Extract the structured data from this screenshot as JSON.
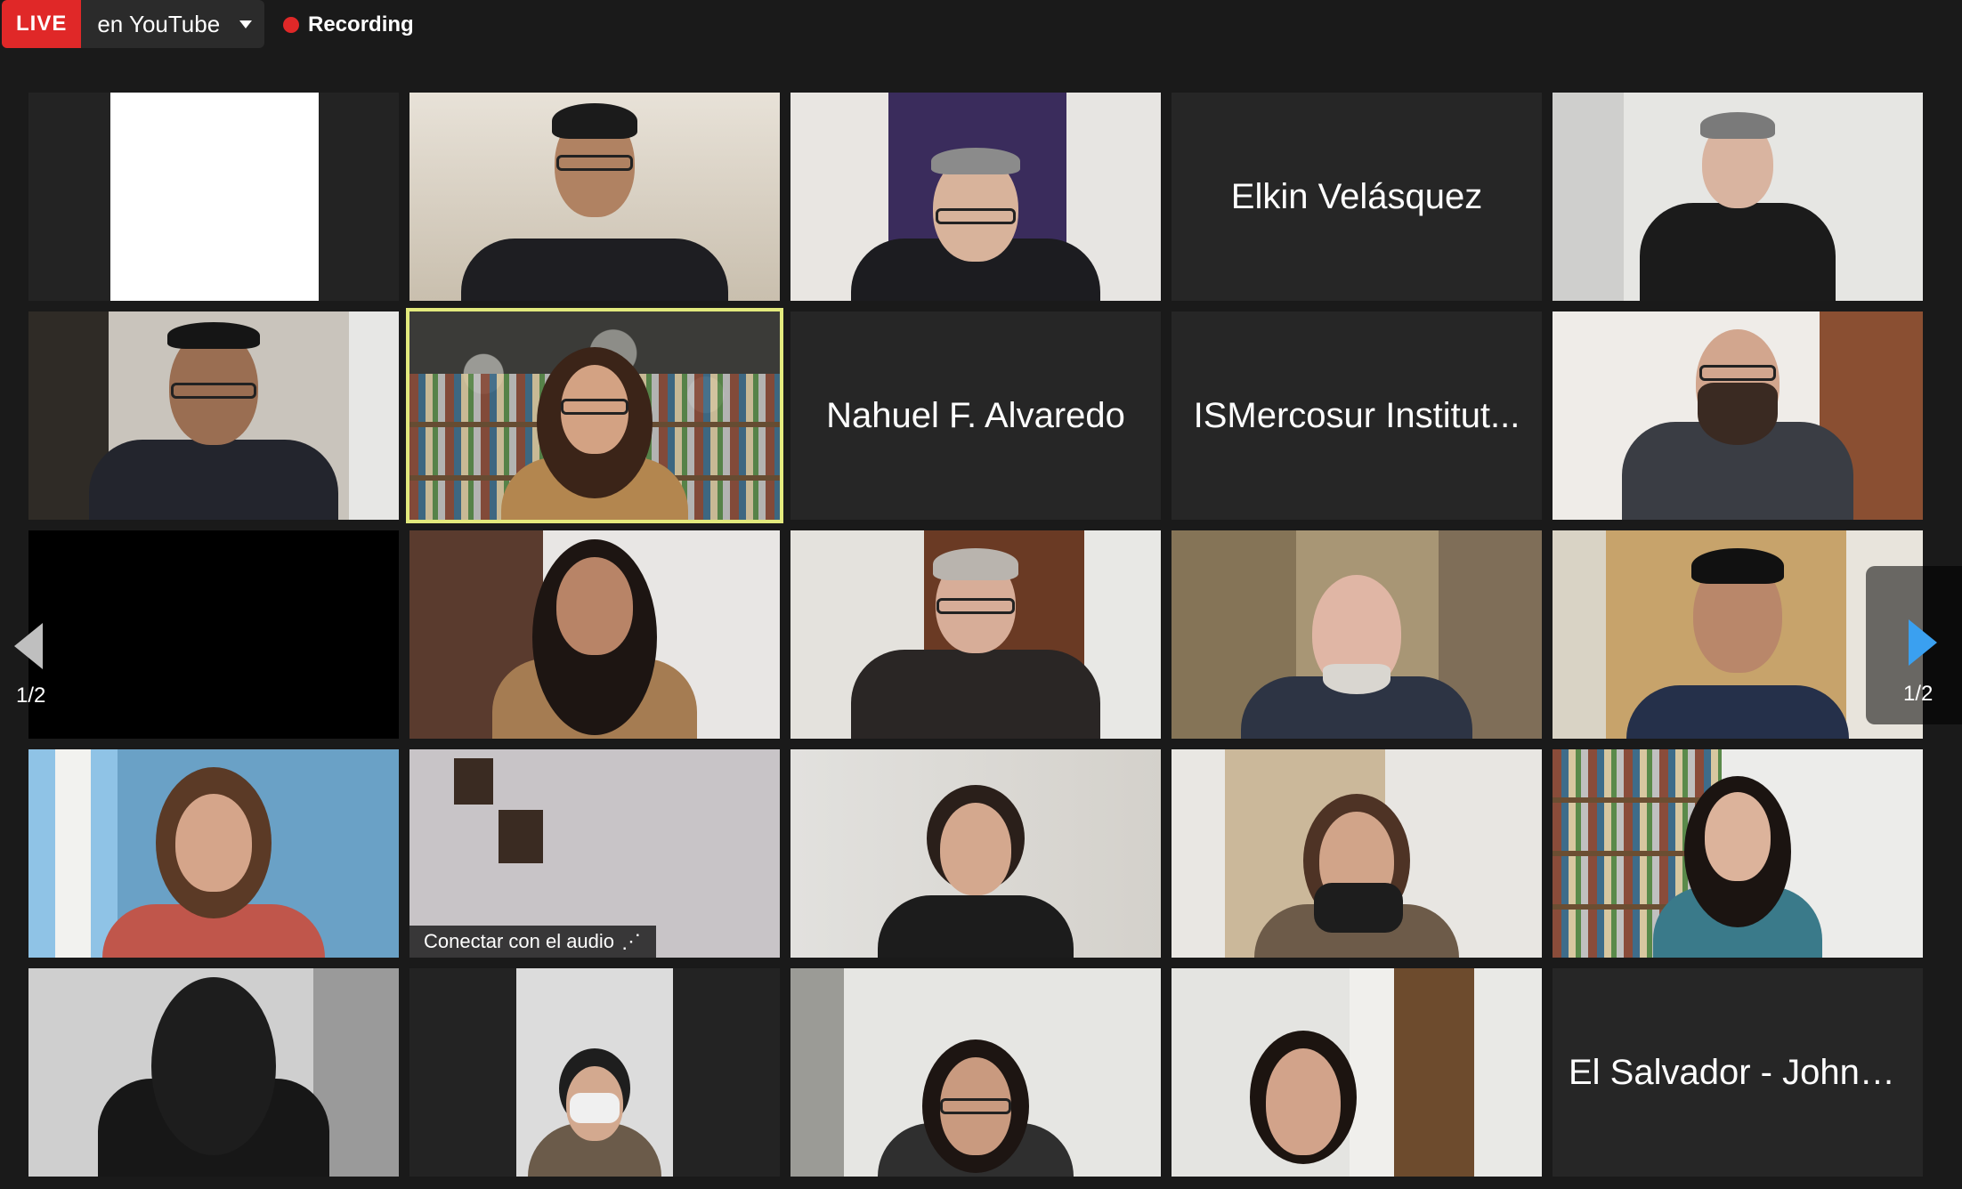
{
  "toolbar": {
    "live_badge": "LIVE",
    "live_platform": "en YouTube",
    "recording_label": "Recording"
  },
  "participants": [
    {
      "type": "video",
      "label": ""
    },
    {
      "type": "video",
      "label": ""
    },
    {
      "type": "video",
      "label": ""
    },
    {
      "type": "name",
      "label": "Elkin Velásquez"
    },
    {
      "type": "video",
      "label": ""
    },
    {
      "type": "video",
      "label": ""
    },
    {
      "type": "video",
      "label": "",
      "active": true
    },
    {
      "type": "name",
      "label": "Nahuel F. Alvaredo"
    },
    {
      "type": "name",
      "label": "ISMercosur Institut..."
    },
    {
      "type": "video",
      "label": ""
    },
    {
      "type": "black",
      "label": ""
    },
    {
      "type": "video",
      "label": ""
    },
    {
      "type": "video",
      "label": ""
    },
    {
      "type": "video",
      "label": ""
    },
    {
      "type": "video",
      "label": ""
    },
    {
      "type": "video",
      "label": ""
    },
    {
      "type": "video",
      "label": "Conectar con el audio"
    },
    {
      "type": "video",
      "label": ""
    },
    {
      "type": "video",
      "label": ""
    },
    {
      "type": "video",
      "label": ""
    },
    {
      "type": "video",
      "label": ""
    },
    {
      "type": "video",
      "label": ""
    },
    {
      "type": "video",
      "label": ""
    },
    {
      "type": "video",
      "label": ""
    },
    {
      "type": "name",
      "label": "El Salvador - Johnn..."
    }
  ],
  "audio_more_glyph": "⋰",
  "pagination": {
    "left_indicator": "1/2",
    "right_indicator": "1/2"
  },
  "colors": {
    "live_red": "#e02828",
    "active_speaker_outline": "#e3ea7d",
    "next_arrow": "#3aa0f0"
  },
  "icons": {
    "dropdown": "chevron-down-icon",
    "recording": "record-dot-icon",
    "prev_page": "arrow-left-icon",
    "next_page": "arrow-right-icon",
    "audio_more": "more-dots-icon"
  }
}
